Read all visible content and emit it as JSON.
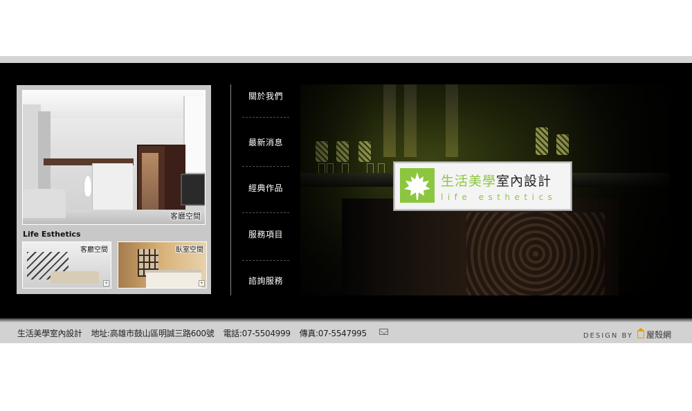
{
  "gallery": {
    "main_caption": "客廳空間",
    "brand_label": "Life Esthetics",
    "thumbs": [
      {
        "caption": "客廳空間"
      },
      {
        "caption": "臥室空間"
      }
    ]
  },
  "nav": {
    "items": [
      {
        "label": "關於我們"
      },
      {
        "label": "最新消息"
      },
      {
        "label": "經典作品"
      },
      {
        "label": "服務項目"
      },
      {
        "label": "諮詢服務"
      }
    ]
  },
  "hero": {
    "logo_zh_green": "生活美學",
    "logo_zh_dark": "室內設計",
    "logo_en": "life esthetics",
    "accent_color": "#8cc63f"
  },
  "footer": {
    "company": "生活美學室內設計",
    "address": "地址:高雄市鼓山區明誠三路600號",
    "phone": "電話:07-5504999",
    "fax": "傳真:07-5547995",
    "credit_prefix": "DESIGN BY",
    "credit_brand": "屋殼網",
    "mail_icon": "mail-icon"
  }
}
